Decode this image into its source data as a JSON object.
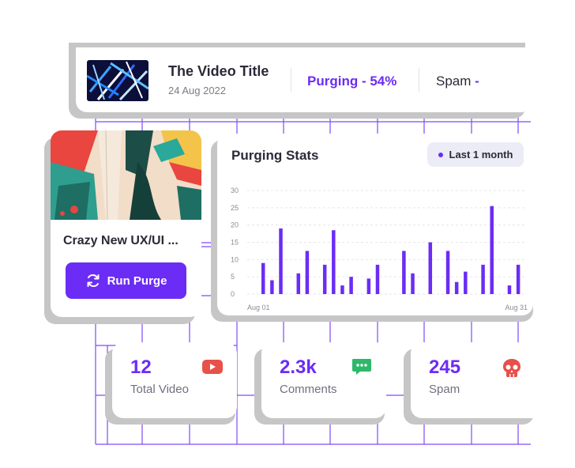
{
  "video": {
    "title": "The Video Title",
    "date": "24 Aug 2022",
    "status": "Purging - 54%",
    "spam_label": "Spam",
    "spam_value": "-"
  },
  "feature": {
    "title": "Crazy New UX/UI ...",
    "button_label": "Run Purge"
  },
  "stats_card": {
    "title": "Purging Stats",
    "period": "Last 1 month"
  },
  "chart_data": {
    "type": "bar",
    "title": "Purging Stats",
    "xlabel": "",
    "ylabel": "",
    "ylim": [
      0,
      30
    ],
    "yticks": [
      0,
      5,
      10,
      15,
      20,
      25,
      30
    ],
    "x_tick_labels": [
      "Aug 01",
      "Aug 31"
    ],
    "categories": [
      "1",
      "2",
      "3",
      "4",
      "5",
      "6",
      "7",
      "8",
      "9",
      "10",
      "11",
      "12",
      "13",
      "14",
      "15",
      "16",
      "17",
      "18",
      "19",
      "20",
      "21",
      "22",
      "23",
      "24",
      "25",
      "26",
      "27",
      "28",
      "29",
      "30",
      "31"
    ],
    "values": [
      9,
      4,
      19,
      0,
      6,
      12.5,
      0,
      8.5,
      18.5,
      2.5,
      5,
      0,
      4.5,
      8.5,
      0,
      0,
      12.5,
      6,
      0,
      15,
      0,
      12.5,
      3.5,
      6.5,
      0,
      8.5,
      25.5,
      0,
      2.5,
      8.5,
      0
    ],
    "grid": true,
    "color": "#6b2cf5"
  },
  "stats": [
    {
      "value": "12",
      "label": "Total Video",
      "icon": "youtube-icon",
      "icon_color": "#e8504a"
    },
    {
      "value": "2.3k",
      "label": "Comments",
      "icon": "comment-icon",
      "icon_color": "#2fb86a"
    },
    {
      "value": "245",
      "label": "Spam",
      "icon": "skull-icon",
      "icon_color": "#e8504a"
    }
  ],
  "colors": {
    "accent": "#6b2cf5",
    "shadow": "#c6c6c6",
    "grid_line": "#6b2cf5"
  }
}
